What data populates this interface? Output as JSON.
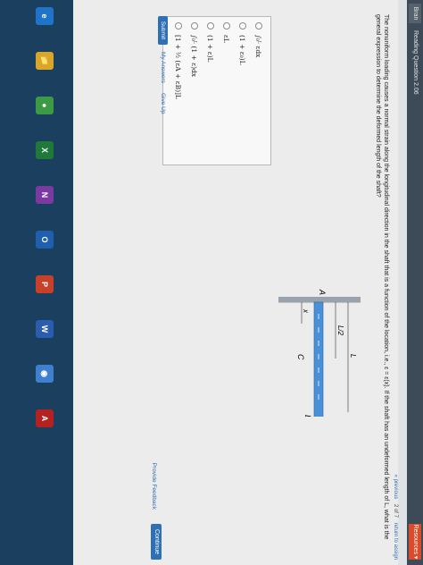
{
  "tabs": [
    "Bran",
    "Reading Question 2.06",
    "Resources ▾"
  ],
  "nav": {
    "previous": "« previous",
    "counter": "2 of 7",
    "return": "return to assign"
  },
  "question": {
    "text": "The nonuniform loading causes a normal strain along the longitudinal direction in the shaft that is a function of the location, i.e., ε = ε(x). If the shaft has an undeformed length of L, what is the general expression to determine the deformed length of the shaft?"
  },
  "figure": {
    "label_L": "L",
    "label_L2": "L/2",
    "label_A": "A",
    "label_B": "B",
    "label_C": "C",
    "label_x": "x"
  },
  "options": [
    "∫₀ᴸ εdx",
    "(1 + ε₀)L",
    "εL",
    "(1 + ε)L",
    "∫₀ᴸ (1 + ε)dx",
    "[1 + ½ (εA + εB)]L"
  ],
  "buttons": {
    "submit": "Submit",
    "my_answers": "My Answers",
    "give_up": "Give Up"
  },
  "footer": {
    "feedback": "Provide Feedback",
    "continue": "Continue"
  },
  "taskbar_icons": [
    "e",
    "📁",
    "●",
    "X",
    "N",
    "O",
    "P",
    "W",
    "◉",
    "A"
  ],
  "colors": {
    "accent": "#2f6fb3",
    "tab_active": "#d94b2b",
    "taskbar": "#1b3f5e",
    "shaft": "#4a90d9"
  }
}
